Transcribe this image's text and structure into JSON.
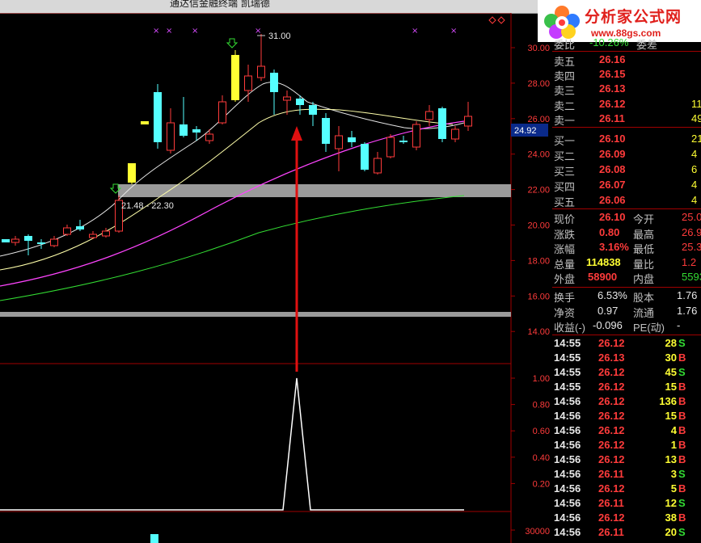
{
  "window": {
    "title": "通达信金融终端    凯瑞德"
  },
  "logo": {
    "text": "分析家公式网",
    "url": "www.88gs.com"
  },
  "main_chart": {
    "high_label": "31.00",
    "range_label": "21.48 - 22.30",
    "current_price_tag": "24.92",
    "y_ticks": [
      "30.00",
      "28.00",
      "26.00",
      "24.00",
      "22.00",
      "20.00",
      "18.00",
      "16.00",
      "14.00"
    ]
  },
  "indicator": {
    "y_ticks": [
      "1.00",
      "0.80",
      "0.60",
      "0.40",
      "0.20"
    ]
  },
  "volume": {
    "y_tick": "30000"
  },
  "order_book": {
    "header_partial": "委比",
    "header_partial_val": "-10.26%",
    "header_partial2": "委差",
    "sell": [
      {
        "label": "卖五",
        "price": "26.16"
      },
      {
        "label": "卖四",
        "price": "26.15"
      },
      {
        "label": "卖三",
        "price": "26.13"
      },
      {
        "label": "卖二",
        "price": "26.12",
        "qty": "11"
      },
      {
        "label": "卖一",
        "price": "26.11",
        "qty": "49"
      }
    ],
    "buy": [
      {
        "label": "买一",
        "price": "26.10",
        "qty": "21"
      },
      {
        "label": "买二",
        "price": "26.09",
        "qty": "4"
      },
      {
        "label": "买三",
        "price": "26.08",
        "qty": "6"
      },
      {
        "label": "买四",
        "price": "26.07",
        "qty": "4"
      },
      {
        "label": "买五",
        "price": "26.06",
        "qty": "4"
      }
    ]
  },
  "quote": {
    "rows": [
      {
        "l1": "现价",
        "v1": "26.10",
        "l2": "今开",
        "v2": "25.0"
      },
      {
        "l1": "涨跌",
        "v1": "0.80",
        "l2": "最高",
        "v2": "26.9"
      },
      {
        "l1": "涨幅",
        "v1": "3.16%",
        "l2": "最低",
        "v2": "25.3"
      },
      {
        "l1": "总量",
        "v1": "114838",
        "l2": "量比",
        "v2": "1.2"
      },
      {
        "l1": "外盘",
        "v1": "58900",
        "l2": "内盘",
        "v2": "5593"
      }
    ],
    "rows2": [
      {
        "l1": "换手",
        "v1": "6.53%",
        "l2": "股本",
        "v2": "1.76"
      },
      {
        "l1": "净资",
        "v1": "0.97",
        "l2": "流通",
        "v2": "1.76"
      },
      {
        "l1": "收益(-)",
        "v1": "-0.096",
        "l2": "PE(动)",
        "v2": "-"
      }
    ]
  },
  "ticks": [
    {
      "time": "14:55",
      "price": "26.12",
      "vol": "28",
      "side": "S"
    },
    {
      "time": "14:55",
      "price": "26.13",
      "vol": "30",
      "side": "B"
    },
    {
      "time": "14:55",
      "price": "26.12",
      "vol": "45",
      "side": "S"
    },
    {
      "time": "14:55",
      "price": "26.12",
      "vol": "15",
      "side": "B"
    },
    {
      "time": "14:56",
      "price": "26.12",
      "vol": "136",
      "side": "B"
    },
    {
      "time": "14:56",
      "price": "26.12",
      "vol": "15",
      "side": "B"
    },
    {
      "time": "14:56",
      "price": "26.12",
      "vol": "4",
      "side": "B"
    },
    {
      "time": "14:56",
      "price": "26.12",
      "vol": "1",
      "side": "B"
    },
    {
      "time": "14:56",
      "price": "26.12",
      "vol": "13",
      "side": "B"
    },
    {
      "time": "14:56",
      "price": "26.11",
      "vol": "3",
      "side": "S"
    },
    {
      "time": "14:56",
      "price": "26.12",
      "vol": "5",
      "side": "B"
    },
    {
      "time": "14:56",
      "price": "26.11",
      "vol": "12",
      "side": "S"
    },
    {
      "time": "14:56",
      "price": "26.12",
      "vol": "38",
      "side": "B"
    },
    {
      "time": "14:56",
      "price": "26.11",
      "vol": "20",
      "side": "S"
    }
  ],
  "colors": {
    "up": "#ff3b3b",
    "down": "#55ffff",
    "signal": "#ffff33",
    "ma5": "#e8e8e8",
    "ma10": "#ffffaa",
    "ma20": "#ff44ff",
    "ma60": "#33dd33",
    "grid": "#a00000"
  }
}
